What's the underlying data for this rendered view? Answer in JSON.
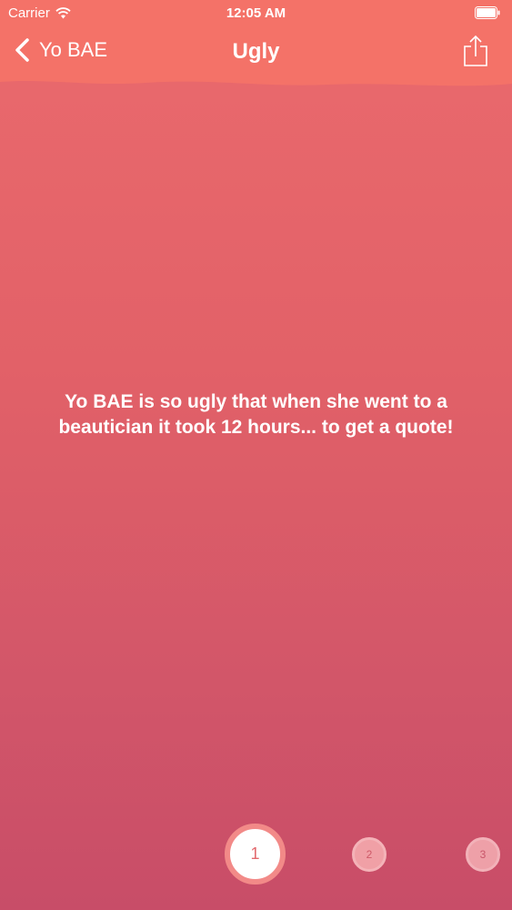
{
  "status_bar": {
    "carrier": "Carrier",
    "time": "12:05 AM",
    "wifi_icon": "wifi-icon",
    "battery_icon": "battery-icon"
  },
  "navbar": {
    "back_label": "Yo BAE",
    "title": "Ugly",
    "share_icon": "share-icon"
  },
  "joke": {
    "text": "Yo BAE is so ugly that when she went to a beautician it took 12 hours... to get a quote!"
  },
  "pager": {
    "pages": [
      "1",
      "2",
      "3"
    ],
    "selected": "1"
  },
  "colors": {
    "background_top": "#ea6a6d",
    "background_bottom": "#c84d68",
    "header": "#f47367",
    "text": "#ffffff"
  }
}
